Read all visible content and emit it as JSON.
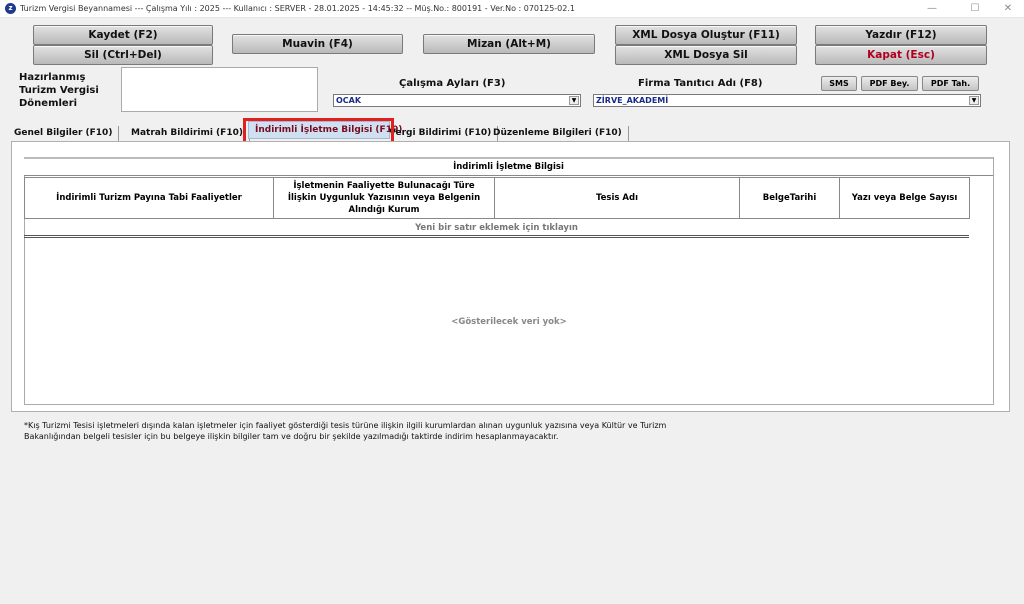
{
  "window": {
    "title": "Turizm Vergisi Beyannamesi  ---  Çalışma Yılı : 2025  ---  Kullanıcı : SERVER - 28.01.2025 - 14:45:32  --  Müş.No.: 800191  -  Ver.No : 070125-02.1",
    "icon_letter": "z",
    "minimize": "—",
    "maximize": "☐",
    "close": "✕"
  },
  "toolbar": {
    "kaydet": "Kaydet (F2)",
    "sil": "Sil (Ctrl+Del)",
    "muavin": "Muavin (F4)",
    "mizan": "Mizan (Alt+M)",
    "xml_olustur": "XML Dosya Oluştur (F11)",
    "xml_sil": "XML Dosya Sil",
    "yazdir": "Yazdır (F12)",
    "kapat": "Kapat (Esc)"
  },
  "header": {
    "donem_label": "Hazırlanmış Turizm Vergisi Dönemleri",
    "calisma_label": "Çalışma Ayları (F3)",
    "calisma_value": "OCAK",
    "firma_label": "Firma Tanıtıcı Adı (F8)",
    "firma_value": "ZİRVE_AKADEMİ",
    "sms": "SMS",
    "pdf_bey": "PDF Bey.",
    "pdf_tah": "PDF Tah."
  },
  "tabs": [
    {
      "label": "Genel Bilgiler (F10)"
    },
    {
      "label": "Matrah Bildirimi (F10)"
    },
    {
      "label": "İndirimli İşletme Bilgisi (F10)"
    },
    {
      "label": "Vergi Bildirimi (F10)"
    },
    {
      "label": "Düzenleme Bilgileri (F10)"
    }
  ],
  "grid": {
    "title": "İndirimli İşletme Bilgisi",
    "columns": [
      "İndirimli Turizm Payına Tabi Faaliyetler",
      "İşletmenin Faaliyette Bulunacağı Türe İlişkin Uygunluk Yazısının veya Belgenin Alındığı Kurum",
      "Tesis Adı",
      "BelgeTarihi",
      "Yazı veya Belge Sayısı"
    ],
    "new_row": "Yeni bir satır eklemek için tıklayın",
    "empty": "<Gösterilecek veri yok>"
  },
  "footnote": "*Kış Turizmi Tesisi işletmeleri dışında kalan işletmeler için faaliyet gösterdiği tesis türüne ilişkin ilgili kurumlardan alınan uygunluk yazısına veya Kültür ve Turizm Bakanlığından belgeli tesisler için bu belgeye ilişkin bilgiler tam ve doğru bir şekilde yazılmadığı taktirde indirim hesaplanmayacaktır.",
  "colors": {
    "highlight": "#e02020",
    "danger_text": "#b00020",
    "active_tab_text": "#7a0b1d"
  }
}
